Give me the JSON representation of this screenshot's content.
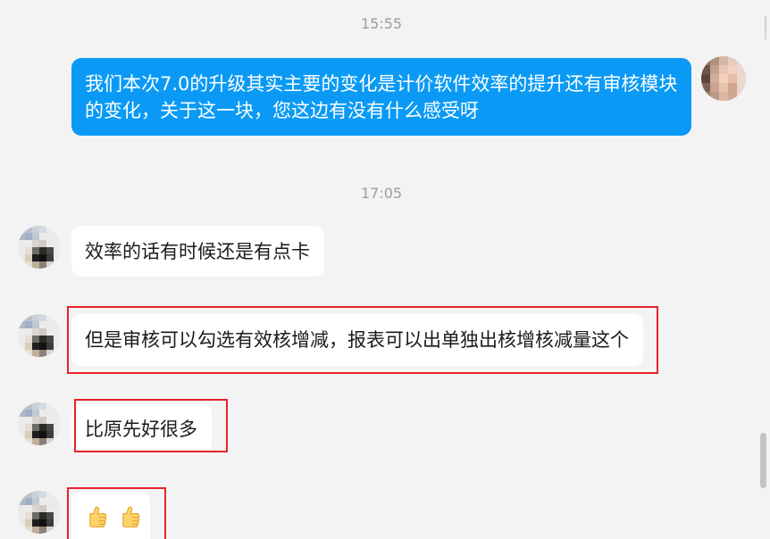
{
  "colors": {
    "background": "#f3f3f3",
    "outgoing_bubble": "#0a9af5",
    "incoming_bubble": "#ffffff",
    "timestamp_text": "#9d9d9d",
    "highlight_box": "#e8232a"
  },
  "chat": {
    "timestamps": [
      "15:55",
      "17:05"
    ],
    "outgoing_messages": [
      {
        "lines": [
          "我们本次7.0的升级其实主要的变化是计价软件效率的提升还有审核模块",
          "的变化，关于这一块，您这边有没有什么感受呀"
        ]
      }
    ],
    "incoming_messages": [
      {
        "text": "效率的话有时候还是有点卡",
        "highlighted": false
      },
      {
        "text": "但是审核可以勾选有效核增减，报表可以出单独出核增核减量这个",
        "highlighted": true
      },
      {
        "text": "比原先好很多",
        "highlighted": true
      },
      {
        "icons": [
          "thumbs-up-icon",
          "thumbs-up-icon"
        ],
        "highlighted": true
      }
    ]
  }
}
